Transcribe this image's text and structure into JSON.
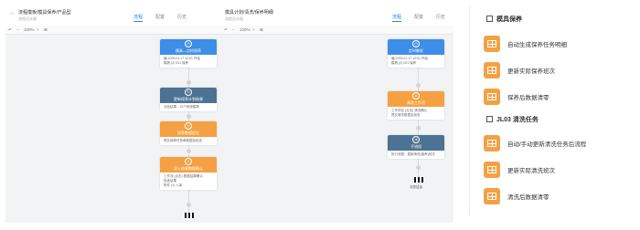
{
  "panel1": {
    "title": "流程模板/模具保养/产品型",
    "subtitle": "流程设计器",
    "tabs": [
      "流程",
      "配置",
      "历史"
    ],
    "active_tab": "流程",
    "toolbar": {
      "zoom": "100%"
    },
    "nodes": [
      {
        "title": "模具—点检保养",
        "body": [
          "编-2025.01.17 12:51 开始",
          "模具 (2) 001 保养"
        ]
      },
      {
        "title": "更新保养计划结果",
        "body": [
          "点检结果：31个系统模具"
        ]
      },
      {
        "title": "保养数据提交",
        "body": [
          "提交保养任务单数据及检查"
        ]
      },
      {
        "title": "导入结果数据确认",
        "body": [
          "工作流 (点击) 数据结果确认",
          "批准结果",
          "附件 (1) 入库"
        ]
      }
    ]
  },
  "panel2": {
    "title": "模具计划/清洗/保养明细",
    "subtitle": "流程设计器",
    "tabs": [
      "流程",
      "配置",
      "历史"
    ],
    "active_tab": "流程",
    "toolbar": {
      "zoom": "100%"
    },
    "nodes": [
      {
        "title": "定时触发",
        "body": [
          "编-2025.01.17 12:51 开始",
          "模具 (2) 001 保养"
        ]
      },
      {
        "title": "清洗工作项",
        "body": [
          "工作项目 (点击) 清洗确认",
          "提交清洗数据及检查"
        ]
      },
      {
        "title": "子流程",
        "body": [
          "执行流程：更新清洗(保养)班次"
        ]
      }
    ],
    "end_label": "流程结束"
  },
  "panel3": {
    "sections": [
      {
        "title": "模具保养",
        "icon": "calendar-icon",
        "items": [
          "自动生成保养任务明细",
          "更新实际保养班次",
          "保养后数据清零"
        ]
      },
      {
        "title": "JL03 清洗任务",
        "icon": "wrench-icon",
        "items": [
          "自动/手动更新清洗任务后流程",
          "更新实际清洗班次",
          "清洗后数据清零"
        ]
      }
    ]
  },
  "colors": {
    "primary": "#3d8ee8",
    "steel": "#4d7394",
    "orange": "#f5a143"
  }
}
